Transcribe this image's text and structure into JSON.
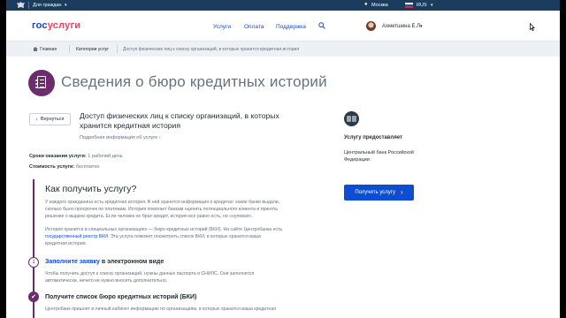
{
  "topbar": {
    "for_citizens": "Для граждан",
    "city": "Москва",
    "lang": "RUS"
  },
  "header": {
    "logo_part1": "гос",
    "logo_part2": "услуги",
    "nav": [
      "Услуги",
      "Оплата",
      "Поддержка"
    ],
    "user_name": "Ахметшина Е.Л."
  },
  "breadcrumb": {
    "home": "Главная",
    "categories": "Категории услуг",
    "current": "Доступ физических лиц к списку организаций, в которых хранится кредитная история"
  },
  "page_title": "Сведения о бюро кредитных историй",
  "back_label": "Вернуться",
  "service": {
    "title_line1": "Доступ физических лиц к списку организаций, в которых",
    "title_line2": "хранится кредитная история",
    "details_link": "Подробная информация об услуге",
    "term_label": "Сроки оказания услуги:",
    "term_value": "1 рабочий день",
    "cost_label": "Стоимость услуги:",
    "cost_value": "бесплатно"
  },
  "howto": {
    "title": "Как получить услугу?",
    "p1_l1": "У каждого гражданина есть кредитная история. В ней хранится информация о кредитах: какие банки выдали,",
    "p1_l2": "сколько было просрочек по платежам. История помогает банкам оценить потенциального клиента и принять",
    "p1_l3": "решение о выдаче кредита. Если человек не брал кредит, история все равно есть, но «нулевая».",
    "p2_l1": "История хранится в специальных организациях — бюро кредитных историй (БКИ). На сайте Центробанка есть",
    "p2_l2_link": "государственный реестр БКИ",
    "p2_l2_rest": ". Эта услуга поможет посмотреть список БКИ, в которых хранится ваша",
    "p2_l3": "кредитная история."
  },
  "steps": [
    {
      "number": "1",
      "title_link": "Заполните заявку",
      "title_rest": " в электронном виде",
      "text_l1": "Чтобы получить доступ к списку организаций, нужны данные паспорта и СНИЛС. Они заполнятся",
      "text_l2": "автоматически, ничего не нужно вносить дополнительно."
    },
    {
      "title": "Получите список бюро кредитных историй (БКИ)",
      "text_l1": "Центробанк пришлет в личный кабинет информацию по организациям, в которых хранится ваша кредитная"
    }
  ],
  "sidebar": {
    "provided_label": "Услугу предоставляет",
    "provider_l1": "Центральный банк Российской",
    "provider_l2": "Федерации",
    "get_button": "Получить услугу"
  },
  "colors": {
    "brand_blue": "#0d4cd3",
    "brand_red": "#ee3f58",
    "accent_purple": "#6b2d6c",
    "topbar": "#1b3c5c"
  }
}
